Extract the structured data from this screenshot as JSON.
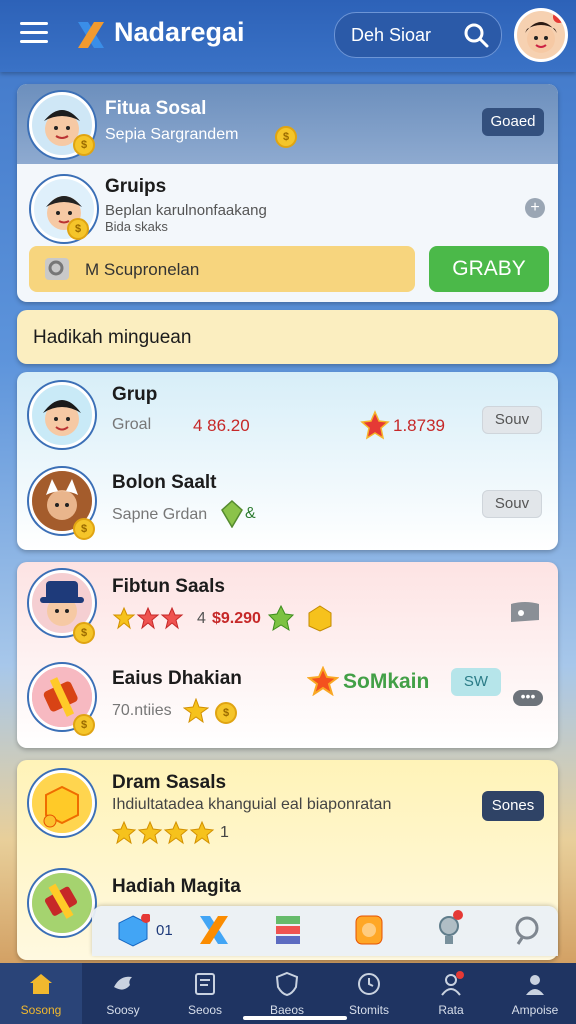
{
  "header": {
    "app_title": "Nadaregai",
    "search_text": "Deh Sioar"
  },
  "social_card": {
    "title": "Fitua Sosal",
    "subtitle": "Sepia Sargrandem",
    "button": "Goaed"
  },
  "groups_card": {
    "title": "Gruips",
    "line1": "Beplan karulnonfaakang",
    "line2": "Bida skaks",
    "plus": "+",
    "input_text": "M Scupronelan",
    "action_button": "GRABY"
  },
  "weekly_banner": {
    "title": "Hadikah minguean"
  },
  "list_blue": [
    {
      "name": "Grup",
      "meta": "Groal",
      "score": "4 86.20",
      "star_value": "1.8739",
      "button": "Souv"
    },
    {
      "name": "Bolon Saalt",
      "meta": "Sapne Grdan",
      "extra": "&",
      "button": "Souv"
    }
  ],
  "list_pink": [
    {
      "name": "Fibtun Saals",
      "rating": "4",
      "value": "$9.290"
    },
    {
      "name": "Eaius Dhakian",
      "brand": "SoMkain",
      "badge": "SW",
      "meta": "70.ntiies"
    }
  ],
  "list_yellow": [
    {
      "name": "Dram Sasals",
      "desc": "Ihdiultatadea khanguial eal biaponratan",
      "rating_count": "1",
      "button": "Sones"
    },
    {
      "name": "Hadiah Magita"
    }
  ],
  "bottom_strip": {
    "count": "01"
  },
  "tabs": [
    {
      "label": "Sosong",
      "icon": "home-icon"
    },
    {
      "label": "Soosy",
      "icon": "bird-icon"
    },
    {
      "label": "Seoos",
      "icon": "document-icon"
    },
    {
      "label": "Baeos",
      "icon": "shield-icon"
    },
    {
      "label": "Stomits",
      "icon": "clock-icon"
    },
    {
      "label": "Rata",
      "icon": "profile-icon"
    },
    {
      "label": "Ampoise",
      "icon": "user-icon"
    }
  ],
  "colors": {
    "header": "#2d62b8",
    "tab_active": "#f1b82e",
    "green_button": "#4bb949"
  }
}
